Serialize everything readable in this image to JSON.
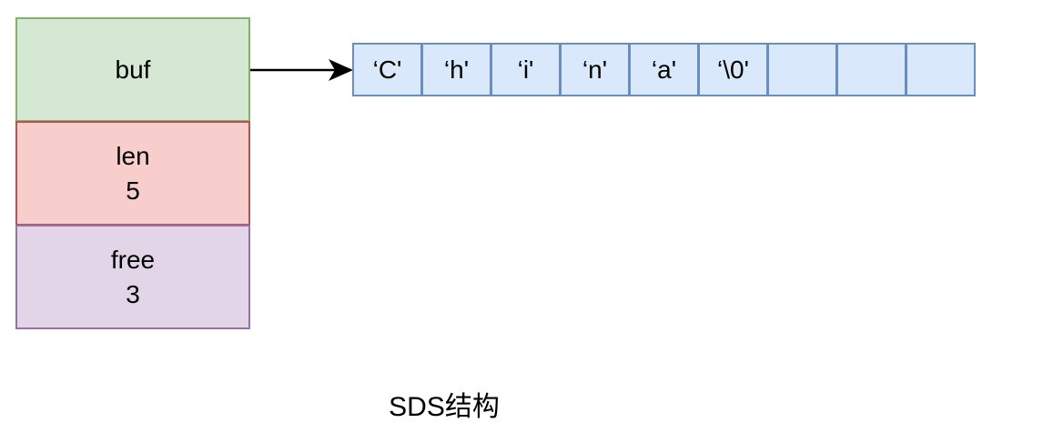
{
  "struct": {
    "buf": {
      "name": "buf"
    },
    "len": {
      "name": "len",
      "value": "5"
    },
    "free": {
      "name": "free",
      "value": "3"
    }
  },
  "buffer_cells": [
    "‘C'",
    "‘h'",
    "‘i'",
    "‘n'",
    "‘a'",
    "‘\\0'",
    "",
    "",
    ""
  ],
  "caption": "SDS结构",
  "colors": {
    "buf_fill": "#d5e8d4",
    "buf_stroke": "#82b366",
    "len_fill": "#f8cecc",
    "len_stroke": "#b85450",
    "free_fill": "#e1d5e7",
    "free_stroke": "#9673a6",
    "cell_fill": "#dae8fc",
    "cell_stroke": "#6c8ebf"
  }
}
